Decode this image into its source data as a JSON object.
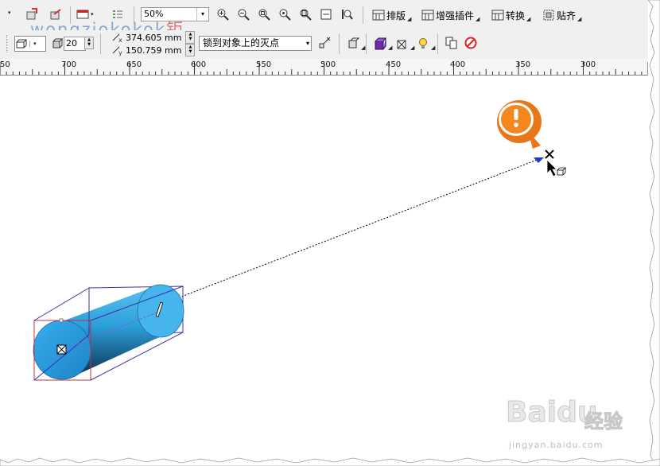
{
  "toolbar_top": {
    "zoom_value": "50%",
    "menus": [
      {
        "label": "排版",
        "icon": "layout-icon"
      },
      {
        "label": "增强插件",
        "icon": "plugin-icon"
      },
      {
        "label": "转换",
        "icon": "convert-icon"
      },
      {
        "label": "贴齐",
        "icon": "snap-icon"
      }
    ]
  },
  "toolbar_property": {
    "depth_value": "20",
    "vanishing_x": "374.605 mm",
    "vanishing_y": "150.759 mm",
    "vanishing_lock": "锁到对象上的灭点"
  },
  "watermark": {
    "text": "wongziokokok",
    "suffix": "钜"
  },
  "ruler": {
    "labels": [
      "50",
      "700",
      "650",
      "600",
      "550",
      "500",
      "450",
      "400",
      "350",
      "300"
    ]
  },
  "brand": {
    "logo": "Baidu",
    "logo_cn": "经验",
    "site": "jingyan.baidu.com"
  },
  "colors": {
    "accent_orange": "#f2881e",
    "cylinder_blue": "#2b9fd9",
    "bbox_red": "#c0304a",
    "vanishing_blue": "#1f38c8"
  }
}
